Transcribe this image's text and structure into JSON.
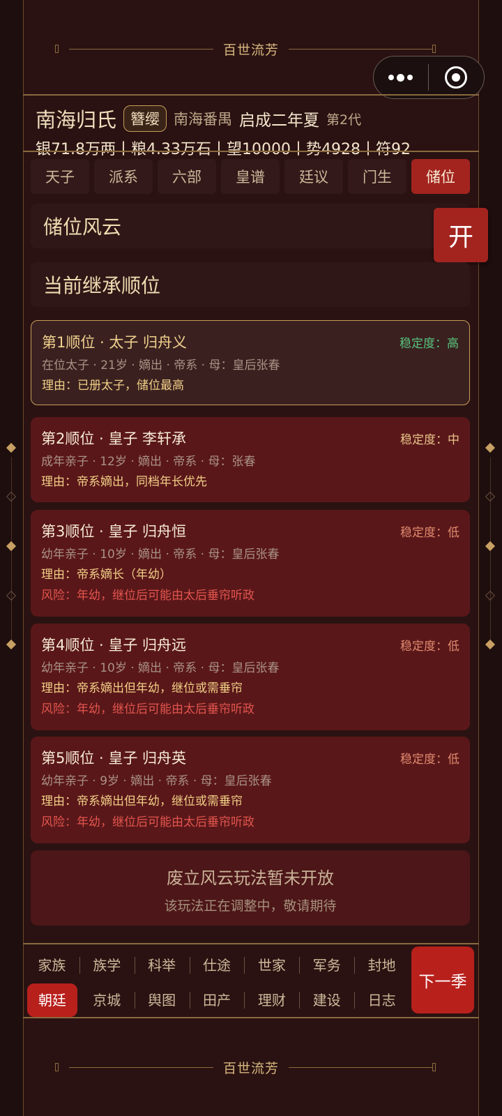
{
  "banner": {
    "title": "百世流芳"
  },
  "capsule": {
    "more_icon": "more-dots-icon",
    "close_icon": "target-icon"
  },
  "header": {
    "clan_name": "南海归氏",
    "rank": "簪缨",
    "region": "南海番禺",
    "era": "启成二年夏",
    "generation": "第2代",
    "resources": "银71.8万两丨粮4.33万石丨望10000丨势4928丨符92"
  },
  "tabs": [
    {
      "label": "天子",
      "active": false
    },
    {
      "label": "派系",
      "active": false
    },
    {
      "label": "六部",
      "active": false
    },
    {
      "label": "皇谱",
      "active": false
    },
    {
      "label": "廷议",
      "active": false
    },
    {
      "label": "门生",
      "active": false
    },
    {
      "label": "储位",
      "active": true
    }
  ],
  "sections": {
    "storm_title": "储位风云",
    "order_title": "当前继承顺位",
    "open_button": "开"
  },
  "heirs": [
    {
      "title": "第1顺位 · 太子 归舟义",
      "stability": "稳定度：高",
      "meta": "在位太子 · 21岁 · 嫡出 · 帝系 · 母：皇后张春",
      "reason": "理由：已册太子，储位最高",
      "risk": ""
    },
    {
      "title": "第2顺位 · 皇子 李轩承",
      "stability": "稳定度：中",
      "meta": "成年亲子 · 12岁 · 嫡出 · 帝系 · 母：张春",
      "reason": "理由：帝系嫡出，同档年长优先",
      "risk": ""
    },
    {
      "title": "第3顺位 · 皇子 归舟恒",
      "stability": "稳定度：低",
      "meta": "幼年亲子 · 10岁 · 嫡出 · 帝系 · 母：皇后张春",
      "reason": "理由：帝系嫡长（年幼）",
      "risk": "风险：年幼，继位后可能由太后垂帘听政"
    },
    {
      "title": "第4顺位 · 皇子 归舟远",
      "stability": "稳定度：低",
      "meta": "幼年亲子 · 10岁 · 嫡出 · 帝系 · 母：皇后张春",
      "reason": "理由：帝系嫡出但年幼，继位或需垂帘",
      "risk": "风险：年幼，继位后可能由太后垂帘听政"
    },
    {
      "title": "第5顺位 · 皇子 归舟英",
      "stability": "稳定度：低",
      "meta": "幼年亲子 · 9岁 · 嫡出 · 帝系 · 母：皇后张春",
      "reason": "理由：帝系嫡出但年幼，继位或需垂帘",
      "risk": "风险：年幼，继位后可能由太后垂帘听政"
    }
  ],
  "notice": {
    "title": "废立风云玩法暂未开放",
    "subtitle": "该玩法正在调整中，敬请期待"
  },
  "bottom_nav": {
    "row1": [
      "家族",
      "族学",
      "科举",
      "仕途",
      "世家",
      "军务",
      "封地"
    ],
    "row2": [
      "朝廷",
      "京城",
      "舆图",
      "田产",
      "理财",
      "建设",
      "日志"
    ],
    "active": "朝廷",
    "next_button": "下一季"
  },
  "colors": {
    "accent_red": "#a3241f",
    "gold": "#c79d5a",
    "stability_high": "#58c27c",
    "risk": "#e2554e"
  }
}
